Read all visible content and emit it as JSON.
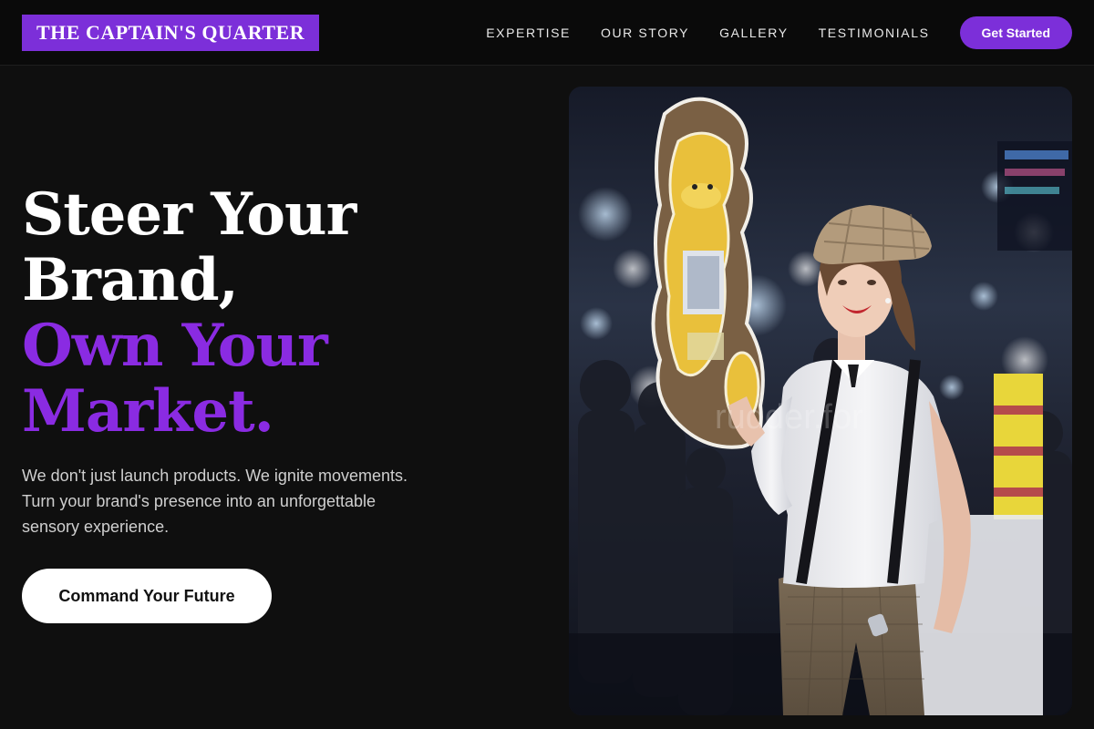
{
  "header": {
    "logo": "THE CAPTAIN'S QUARTER",
    "nav": [
      "EXPERTISE",
      "OUR STORY",
      "GALLERY",
      "TESTIMONIALS"
    ],
    "cta_label": "Get Started"
  },
  "hero": {
    "title_lines": {
      "line1": "Steer Your",
      "line2": "Brand,",
      "line3": "Own Your",
      "line4": "Market."
    },
    "description": "We don't just launch products. We ignite movements. Turn your brand's presence into an unforgettable sensory experience.",
    "button_label": "Command Your Future"
  },
  "image": {
    "watermark": "rudder.for"
  },
  "colors": {
    "accent": "#8a2be2",
    "button_purple": "#7c2fd9",
    "background": "#0f0f0f"
  }
}
